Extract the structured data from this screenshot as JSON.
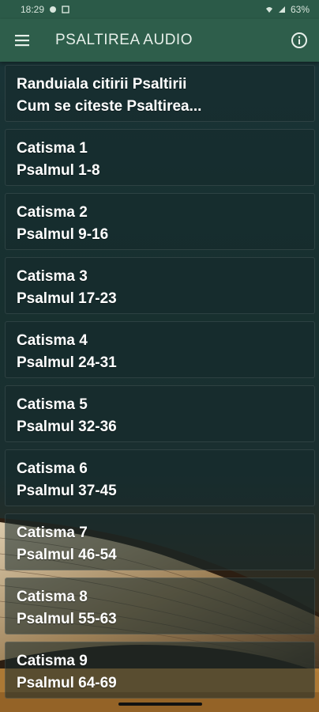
{
  "status_bar": {
    "time": "18:29",
    "battery": "63%"
  },
  "app_bar": {
    "title": "PSALTIREA AUDIO",
    "menu_icon": "hamburger-menu-icon",
    "info_icon": "info-icon"
  },
  "items": [
    {
      "title": "Randuiala citirii Psaltirii",
      "subtitle": "Cum se citeste Psaltirea..."
    },
    {
      "title": "Catisma 1",
      "subtitle": "Psalmul 1-8"
    },
    {
      "title": "Catisma 2",
      "subtitle": "Psalmul 9-16"
    },
    {
      "title": "Catisma 3",
      "subtitle": "Psalmul 17-23"
    },
    {
      "title": "Catisma 4",
      "subtitle": "Psalmul 24-31"
    },
    {
      "title": "Catisma 5",
      "subtitle": "Psalmul 32-36"
    },
    {
      "title": "Catisma 6",
      "subtitle": "Psalmul 37-45"
    },
    {
      "title": "Catisma 7",
      "subtitle": "Psalmul 46-54"
    },
    {
      "title": "Catisma 8",
      "subtitle": "Psalmul 55-63"
    },
    {
      "title": "Catisma 9",
      "subtitle": "Psalmul 64-69"
    }
  ],
  "colors": {
    "app_bar": "#2e5e4b",
    "status_bar": "#2b5a48",
    "background": "#1a2f30",
    "text": "#ffffff"
  }
}
